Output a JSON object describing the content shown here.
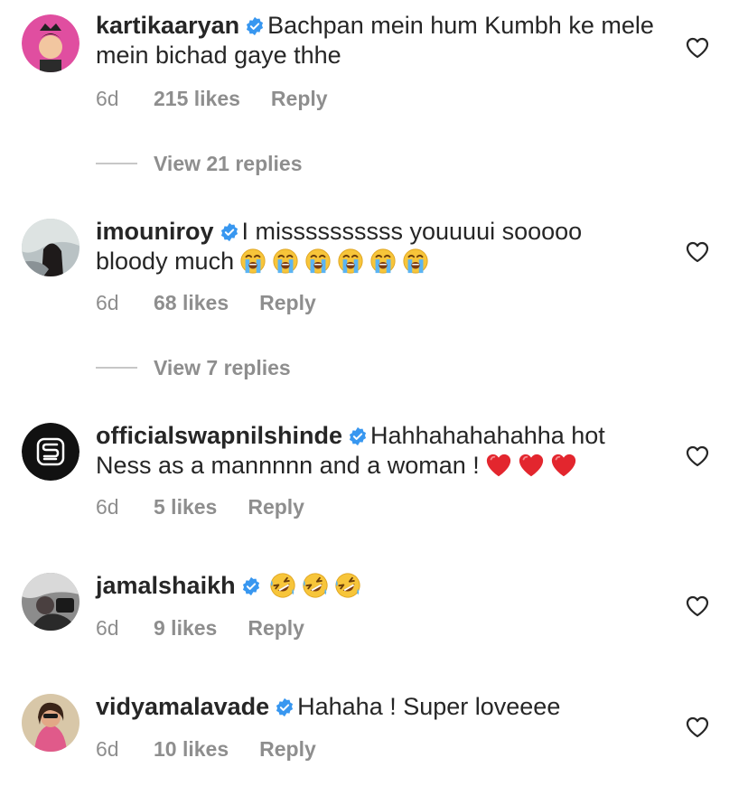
{
  "comments": [
    {
      "username": "kartikaaryan",
      "text": "Bachpan mein hum Kumbh ke mele mein bichad gaye thhe",
      "emojis": [],
      "time": "6d",
      "likes": "215 likes",
      "reply": "Reply",
      "verified": true,
      "avatar_color": "#e04ea0"
    },
    {
      "username": "imouniroy",
      "text": "I missssssssss youuuui sooooo bloody much",
      "emojis": [
        "loudly-crying-face",
        "loudly-crying-face",
        "loudly-crying-face",
        "loudly-crying-face",
        "loudly-crying-face",
        "loudly-crying-face"
      ],
      "time": "6d",
      "likes": "68 likes",
      "reply": "Reply",
      "verified": true,
      "avatar_color": "#9aa4a8"
    },
    {
      "username": "officialswapnilshinde",
      "text": "Hahhahahahahha hot Ness as a mannnnn and a woman !",
      "emojis": [
        "red-heart",
        "red-heart",
        "red-heart"
      ],
      "time": "6d",
      "likes": "5 likes",
      "reply": "Reply",
      "verified": true,
      "avatar_color": "#111111"
    },
    {
      "username": "jamalshaikh",
      "text": "",
      "emojis": [
        "rolling-on-floor-laughing",
        "rolling-on-floor-laughing",
        "rolling-on-floor-laughing"
      ],
      "time": "6d",
      "likes": "9 likes",
      "reply": "Reply",
      "verified": true,
      "avatar_color": "#5a5a5a"
    },
    {
      "username": "vidyamalavade",
      "text": "Hahaha ! Super loveeee",
      "emojis": [],
      "time": "6d",
      "likes": "10 likes",
      "reply": "Reply",
      "verified": true,
      "avatar_color": "#c96a5a"
    }
  ],
  "view_replies": [
    {
      "label": "View 21 replies"
    },
    {
      "label": "View 7 replies"
    }
  ],
  "colors": {
    "text": "#262626",
    "secondary": "#8e8e8e",
    "verified_blue": "#3897f0",
    "heart_outline": "#262626"
  }
}
